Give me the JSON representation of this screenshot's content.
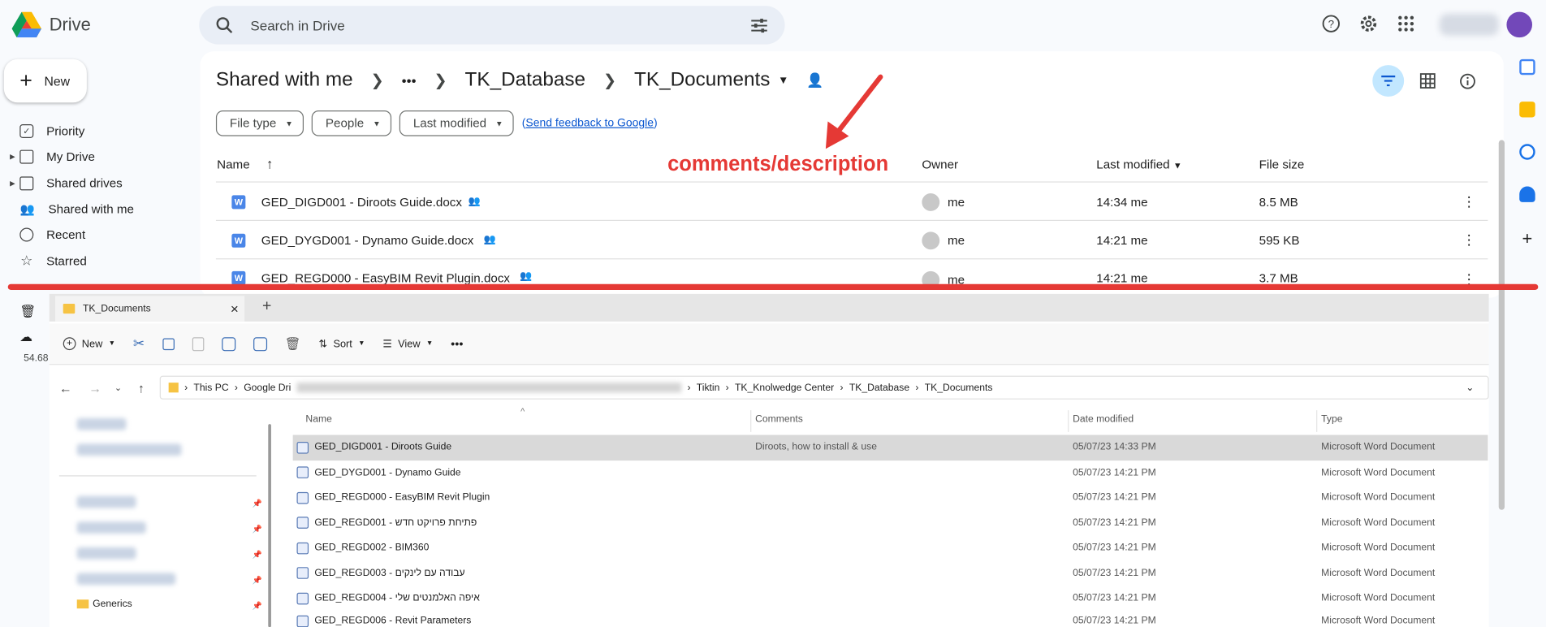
{
  "drive": {
    "app_name": "Drive",
    "search_placeholder": "Search in Drive",
    "new_label": "New",
    "sidebar": [
      {
        "label": "Priority",
        "icon": "priority-icon"
      },
      {
        "label": "My Drive",
        "icon": "my-drive-icon"
      },
      {
        "label": "Shared drives",
        "icon": "shared-drives-icon"
      },
      {
        "label": "Shared with me",
        "icon": "shared-with-me-icon"
      },
      {
        "label": "Recent",
        "icon": "clock-icon"
      },
      {
        "label": "Starred",
        "icon": "star-icon"
      }
    ],
    "storage": "54.68",
    "breadcrumb": {
      "root": "Shared with me",
      "ellipsis": "•••",
      "parent": "TK_Database",
      "current": "TK_Documents"
    },
    "filters": [
      "File type",
      "People",
      "Last modified"
    ],
    "feedback_open": "(",
    "feedback_link": "Send feedback to Google",
    "feedback_close": ")",
    "columns": {
      "name": "Name",
      "owner": "Owner",
      "last_modified": "Last modified",
      "file_size": "File size"
    },
    "files": [
      {
        "name": "GED_DIGD001 - Diroots Guide.docx",
        "owner": "me",
        "modified": "14:34 me",
        "size": "8.5 MB"
      },
      {
        "name": "GED_DYGD001 - Dynamo Guide.docx",
        "owner": "me",
        "modified": "14:21 me",
        "size": "595 KB"
      },
      {
        "name": "GED_REGD000 - EasyBIM Revit Plugin.docx",
        "owner": "me",
        "modified": "14:21 me",
        "size": "3.7 MB"
      }
    ]
  },
  "annotation": "comments/description",
  "explorer": {
    "tab_title": "TK_Documents",
    "toolbar": {
      "new": "New",
      "sort": "Sort",
      "view": "View",
      "more": "•••"
    },
    "path": [
      "This PC",
      "Google Dri",
      "Tiktin",
      "TK_Knolwedge Center",
      "TK_Database",
      "TK_Documents"
    ],
    "nav_last": "Generics",
    "columns": {
      "name": "Name",
      "comments": "Comments",
      "date": "Date modified",
      "type": "Type"
    },
    "files": [
      {
        "name": "GED_DIGD001 - Diroots Guide",
        "comment": "Diroots, how to install & use",
        "date": "05/07/23 14:33 PM",
        "type": "Microsoft Word Document"
      },
      {
        "name": "GED_DYGD001 - Dynamo Guide",
        "comment": "",
        "date": "05/07/23 14:21 PM",
        "type": "Microsoft Word Document"
      },
      {
        "name": "GED_REGD000 - EasyBIM Revit Plugin",
        "comment": "",
        "date": "05/07/23 14:21 PM",
        "type": "Microsoft Word Document"
      },
      {
        "name": "GED_REGD001 - פתיחת פרויקט חדש",
        "comment": "",
        "date": "05/07/23 14:21 PM",
        "type": "Microsoft Word Document"
      },
      {
        "name": "GED_REGD002 - BIM360",
        "comment": "",
        "date": "05/07/23 14:21 PM",
        "type": "Microsoft Word Document"
      },
      {
        "name": "GED_REGD003 - עבודה עם לינקים",
        "comment": "",
        "date": "05/07/23 14:21 PM",
        "type": "Microsoft Word Document"
      },
      {
        "name": "GED_REGD004 - איפה האלמנטים שלי",
        "comment": "",
        "date": "05/07/23 14:21 PM",
        "type": "Microsoft Word Document"
      },
      {
        "name": "GED_REGD006 - Revit Parameters",
        "comment": "",
        "date": "05/07/23 14:21 PM",
        "type": "Microsoft Word Document"
      }
    ]
  },
  "colors": {
    "accent": "#0b57d0",
    "annotation": "#e53935",
    "filter_active": "#c2e7ff"
  }
}
